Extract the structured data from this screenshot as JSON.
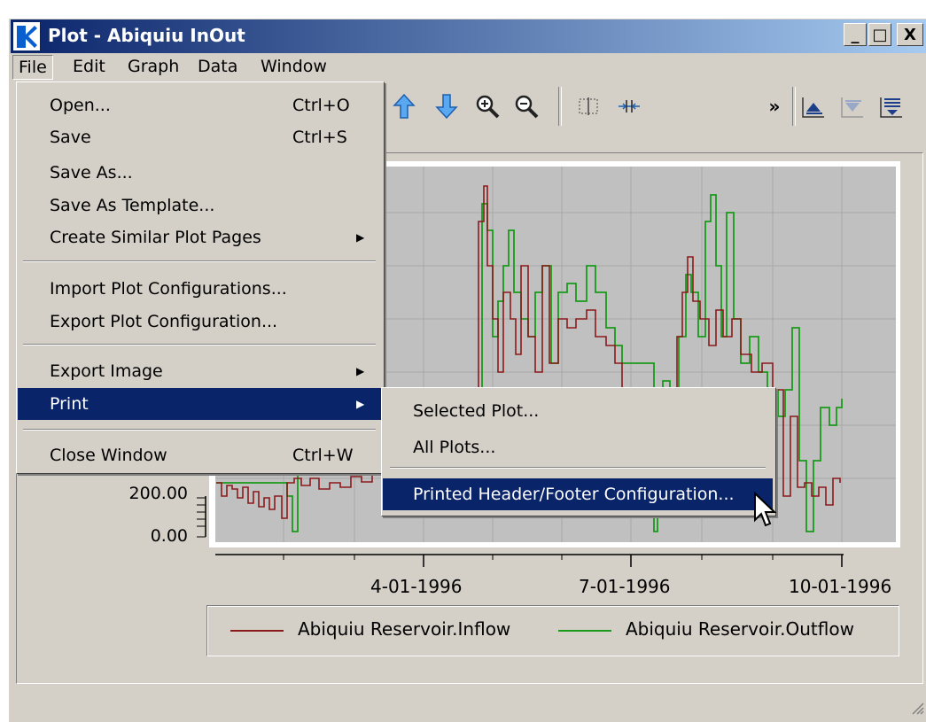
{
  "window": {
    "title": "Plot - Abiquiu InOut",
    "minimize": "_",
    "restore": "□",
    "close": "X"
  },
  "menubar": {
    "items": [
      "File",
      "Edit",
      "Graph",
      "Data",
      "Window"
    ]
  },
  "file_menu": {
    "items": [
      {
        "label": "Open...",
        "shortcut": "Ctrl+O"
      },
      {
        "label": "Save",
        "shortcut": "Ctrl+S"
      },
      {
        "label": "Save As...",
        "shortcut": ""
      },
      {
        "label": "Save As Template...",
        "shortcut": ""
      },
      {
        "label": "Create Similar Plot Pages",
        "shortcut": "",
        "submenu": true
      },
      {
        "label": "Import Plot Configurations...",
        "shortcut": ""
      },
      {
        "label": "Export Plot Configuration...",
        "shortcut": ""
      },
      {
        "label": "Export Image",
        "shortcut": "",
        "submenu": true
      },
      {
        "label": "Print",
        "shortcut": "",
        "submenu": true,
        "highlighted": true
      },
      {
        "label": "Close Window",
        "shortcut": "Ctrl+W"
      }
    ]
  },
  "print_submenu": {
    "items": [
      {
        "label": "Selected Plot..."
      },
      {
        "label": "All Plots..."
      },
      {
        "label": "Printed Header/Footer Configuration...",
        "highlighted": true
      }
    ]
  },
  "toolbar": {
    "icons": [
      "arrow-up-icon",
      "arrow-down-icon",
      "zoom-in-icon",
      "zoom-out-icon",
      "split-view-icon",
      "collapse-icon",
      "more-icon",
      "raise-series-icon",
      "lower-series-icon",
      "list-icon"
    ],
    "more_label": "»"
  },
  "chart_data": {
    "type": "line",
    "x_ticks": [
      "4-01-1996",
      "7-01-1996",
      "10-01-1996"
    ],
    "y_ticks": [
      "200.00",
      "0.00"
    ],
    "series": [
      {
        "name": "Abiquiu Reservoir.Inflow",
        "color": "#8b1a1a"
      },
      {
        "name": "Abiquiu Reservoir.Outflow",
        "color": "#1a9a1a"
      }
    ],
    "grid": true
  },
  "legend": {
    "inflow": "Abiquiu Reservoir.Inflow",
    "outflow": "Abiquiu Reservoir.Outflow"
  },
  "colors": {
    "highlight": "#0a246a",
    "chrome": "#d4d0c8",
    "plot_bg": "#c0c0c0",
    "inflow": "#8b1a1a",
    "outflow": "#1a9a1a"
  }
}
